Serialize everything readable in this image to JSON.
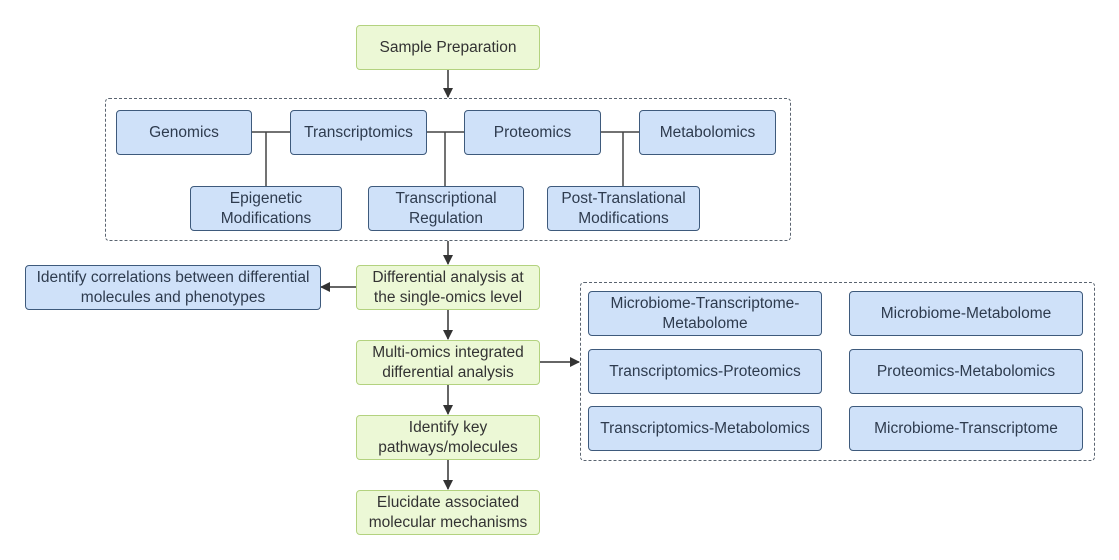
{
  "diagram": {
    "start": "Sample Preparation",
    "omics_layers": {
      "primary": [
        "Genomics",
        "Transcriptomics",
        "Proteomics",
        "Metabolomics"
      ],
      "links": [
        "Epigenetic Modifications",
        "Transcriptional Regulation",
        "Post-Translational Modifications"
      ]
    },
    "flow": [
      "Differential analysis at the single-omics level",
      "Multi-omics integrated differential analysis",
      "Identify key pathways/molecules",
      "Elucidate associated molecular mechanisms"
    ],
    "side_output": "Identify correlations between differential molecules and phenotypes",
    "integrations": [
      "Microbiome-Transcriptome-Metabolome",
      "Microbiome-Metabolome",
      "Transcriptomics-Proteomics",
      "Proteomics-Metabolomics",
      "Transcriptomics-Metabolomics",
      "Microbiome-Transcriptome"
    ],
    "colors": {
      "process_fill": "#ecf8d6",
      "process_border": "#b3d27f",
      "data_fill": "#cfe1f9",
      "data_border": "#3e5a7c",
      "line": "#333333"
    }
  }
}
